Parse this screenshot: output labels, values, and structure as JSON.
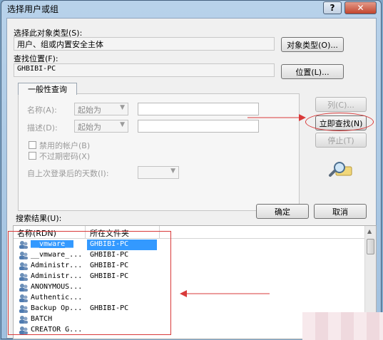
{
  "window": {
    "title": "选择用户或组",
    "help": "?",
    "close": "✕"
  },
  "object_type": {
    "label": "选择此对象类型(S):",
    "value": "用户、组或内置安全主体",
    "button": "对象类型(O)..."
  },
  "location": {
    "label": "查找位置(F):",
    "value": "GHBIBI-PC",
    "button": "位置(L)..."
  },
  "tab": {
    "label": "一般性查询"
  },
  "query": {
    "name_label": "名称(A):",
    "name_mode": "起始为",
    "desc_label": "描述(D):",
    "desc_mode": "起始为",
    "disabled_accounts": "禁用的帐户(B)",
    "no_expire_pw": "不过期密码(X)",
    "days_label": "自上次登录后的天数(I):"
  },
  "side_buttons": {
    "columns": "列(C)...",
    "find_now": "立即查找(N)",
    "stop": "停止(T)"
  },
  "results": {
    "label": "搜索结果(U):"
  },
  "footer": {
    "ok": "确定",
    "cancel": "取消"
  },
  "table": {
    "columns": [
      "名称(RDN)",
      "所在文件夹"
    ],
    "rows": [
      {
        "name": "__vmware__",
        "folder": "GHBIBI-PC",
        "selected": true
      },
      {
        "name": "__vmware_...",
        "folder": "GHBIBI-PC"
      },
      {
        "name": "Administr...",
        "folder": "GHBIBI-PC"
      },
      {
        "name": "Administr...",
        "folder": "GHBIBI-PC"
      },
      {
        "name": "ANONYMOUS...",
        "folder": ""
      },
      {
        "name": "Authentic...",
        "folder": ""
      },
      {
        "name": "Backup Op...",
        "folder": "GHBIBI-PC"
      },
      {
        "name": "BATCH",
        "folder": ""
      },
      {
        "name": "CREATOR G...",
        "folder": ""
      }
    ]
  },
  "colors": {
    "annotation": "#d93a3a",
    "selection": "#3399ff",
    "title_bar": "#b8d2ea"
  }
}
